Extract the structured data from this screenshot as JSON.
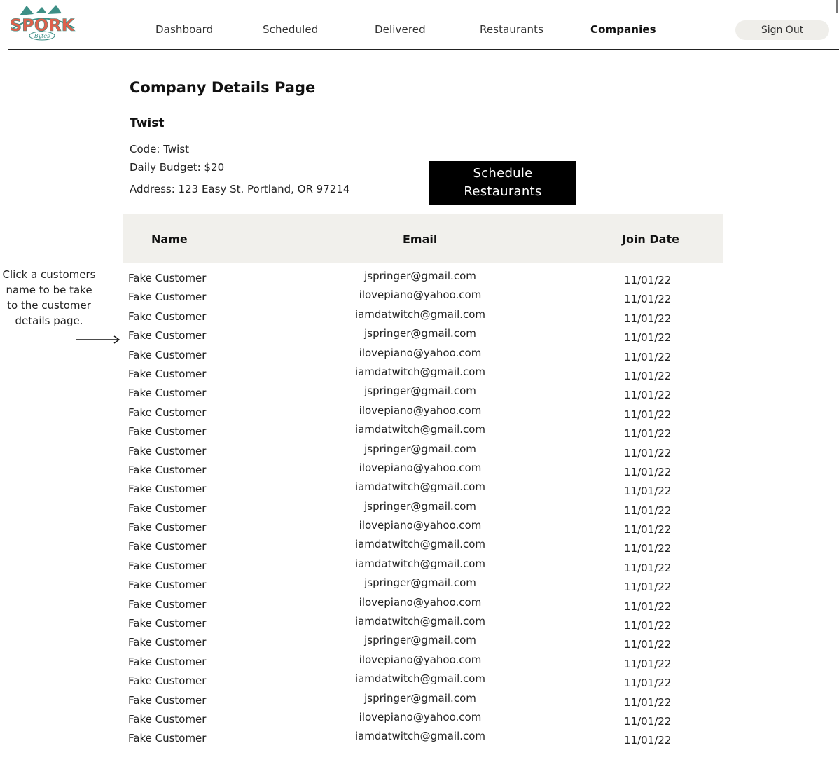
{
  "brand": {
    "logo_text": "SPORK",
    "logo_subtext": "Bytes",
    "colors": {
      "logo_red": "#e0604c",
      "logo_teal": "#3d8f86"
    }
  },
  "nav": {
    "items": [
      {
        "label": "Dashboard",
        "active": false
      },
      {
        "label": "Scheduled",
        "active": false
      },
      {
        "label": "Delivered",
        "active": false
      },
      {
        "label": "Restaurants",
        "active": false
      },
      {
        "label": "Companies",
        "active": true
      }
    ],
    "sign_out": "Sign Out"
  },
  "page": {
    "title": "Company Details Page",
    "company": {
      "name": "Twist",
      "code": "Code: Twist",
      "budget": "Daily Budget: $20",
      "address": "Address: 123 Easy St. Portland, OR 97214"
    },
    "schedule_button": "Schedule Restaurants"
  },
  "table": {
    "headers": {
      "name": "Name",
      "email": "Email",
      "join_date": "Join Date"
    },
    "rows": [
      {
        "name": "Fake Customer",
        "email": "jspringer@gmail.com",
        "date": "11/01/22"
      },
      {
        "name": "Fake Customer",
        "email": "ilovepiano@yahoo.com",
        "date": "11/01/22"
      },
      {
        "name": "Fake Customer",
        "email": "iamdatwitch@gmail.com",
        "date": "11/01/22"
      },
      {
        "name": "Fake Customer",
        "email": "jspringer@gmail.com",
        "date": "11/01/22"
      },
      {
        "name": "Fake Customer",
        "email": "ilovepiano@yahoo.com",
        "date": "11/01/22"
      },
      {
        "name": "Fake Customer",
        "email": "iamdatwitch@gmail.com",
        "date": "11/01/22"
      },
      {
        "name": "Fake Customer",
        "email": "jspringer@gmail.com",
        "date": "11/01/22"
      },
      {
        "name": "Fake Customer",
        "email": "ilovepiano@yahoo.com",
        "date": "11/01/22"
      },
      {
        "name": "Fake Customer",
        "email": "iamdatwitch@gmail.com",
        "date": "11/01/22"
      },
      {
        "name": "Fake Customer",
        "email": "jspringer@gmail.com",
        "date": "11/01/22"
      },
      {
        "name": "Fake Customer",
        "email": "ilovepiano@yahoo.com",
        "date": "11/01/22"
      },
      {
        "name": "Fake Customer",
        "email": "iamdatwitch@gmail.com",
        "date": "11/01/22"
      },
      {
        "name": "Fake Customer",
        "email": "jspringer@gmail.com",
        "date": "11/01/22"
      },
      {
        "name": "Fake Customer",
        "email": "ilovepiano@yahoo.com",
        "date": "11/01/22"
      },
      {
        "name": "Fake Customer",
        "email": "iamdatwitch@gmail.com",
        "date": "11/01/22"
      },
      {
        "name": "Fake Customer",
        "email": "iamdatwitch@gmail.com",
        "date": "11/01/22"
      },
      {
        "name": "Fake Customer",
        "email": "jspringer@gmail.com",
        "date": "11/01/22"
      },
      {
        "name": "Fake Customer",
        "email": "ilovepiano@yahoo.com",
        "date": "11/01/22"
      },
      {
        "name": "Fake Customer",
        "email": "iamdatwitch@gmail.com",
        "date": "11/01/22"
      },
      {
        "name": "Fake Customer",
        "email": "jspringer@gmail.com",
        "date": "11/01/22"
      },
      {
        "name": "Fake Customer",
        "email": "ilovepiano@yahoo.com",
        "date": "11/01/22"
      },
      {
        "name": "Fake Customer",
        "email": "iamdatwitch@gmail.com",
        "date": "11/01/22"
      },
      {
        "name": "Fake Customer",
        "email": "jspringer@gmail.com",
        "date": "11/01/22"
      },
      {
        "name": "Fake Customer",
        "email": "ilovepiano@yahoo.com",
        "date": "11/01/22"
      },
      {
        "name": "Fake Customer",
        "email": "iamdatwitch@gmail.com",
        "date": "11/01/22"
      }
    ]
  },
  "annotation": {
    "text": "Click a customers name to be take to the customer details page."
  }
}
